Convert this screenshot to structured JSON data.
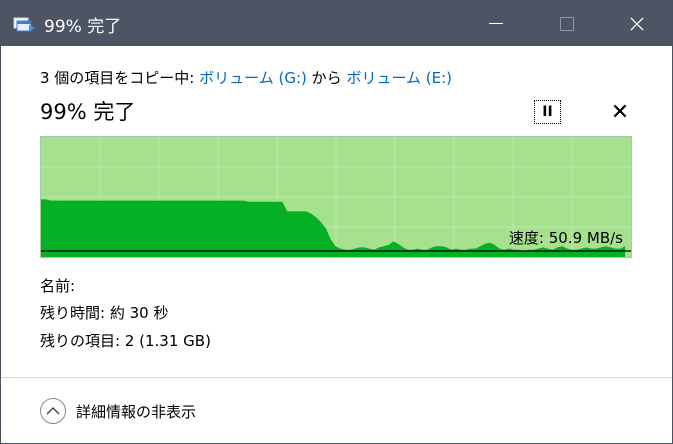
{
  "titlebar": {
    "title": "99% 完了"
  },
  "copy": {
    "prefix": "3 個の項目をコピー中:",
    "source": "ボリューム (G:)",
    "middle": "から",
    "destination": "ボリューム (E:)"
  },
  "progress": {
    "title": "99% 完了",
    "percent": 99
  },
  "controls": {
    "pause_icon": "pause-icon",
    "cancel_icon": "close-icon",
    "pause_glyph": "II",
    "cancel_glyph": "✕"
  },
  "speed": {
    "label": "速度: 50.9 MB/s",
    "current": 50.9,
    "unit": "MB/s"
  },
  "info": {
    "name_label": "名前:",
    "time_label": "残り時間: 約 30 秒",
    "items_label": "残りの項目: 2 (1.31 GB)"
  },
  "footer": {
    "details_label": "詳細情報の非表示"
  },
  "colors": {
    "titlebar": "#4d5564",
    "graph_bg": "#a6e18e",
    "graph_fill": "#06b025",
    "link": "#0066cc"
  },
  "chart_data": {
    "type": "area",
    "title": "",
    "xlabel": "",
    "ylabel": "",
    "ylim": [
      0,
      100
    ],
    "grid": true,
    "progress_fraction": 0.99,
    "values": [
      48,
      48,
      47,
      47,
      47,
      47,
      47,
      47,
      47,
      47,
      47,
      47,
      47,
      47,
      47,
      47,
      47,
      47,
      47,
      47,
      47,
      47,
      47,
      47,
      47,
      47,
      47,
      47,
      47,
      47,
      47,
      47,
      47,
      47,
      47,
      47,
      47,
      47,
      47,
      47,
      47,
      47,
      47,
      46,
      46,
      46,
      46,
      46,
      46,
      46,
      46,
      38,
      38,
      38,
      38,
      38,
      36,
      33,
      29,
      24,
      15,
      9,
      7,
      6,
      6,
      7,
      8,
      8,
      7,
      6,
      8,
      9,
      10,
      13,
      11,
      8,
      6,
      6,
      7,
      6,
      6,
      8,
      9,
      9,
      8,
      6,
      7,
      6,
      6,
      7,
      7,
      9,
      11,
      12,
      10,
      7,
      6,
      7,
      6,
      6,
      5,
      6,
      6,
      7,
      8,
      7,
      6,
      8,
      9,
      7,
      6,
      6,
      7,
      8,
      7,
      7,
      8,
      9,
      8,
      7,
      7,
      9
    ],
    "speed_line": 5
  }
}
